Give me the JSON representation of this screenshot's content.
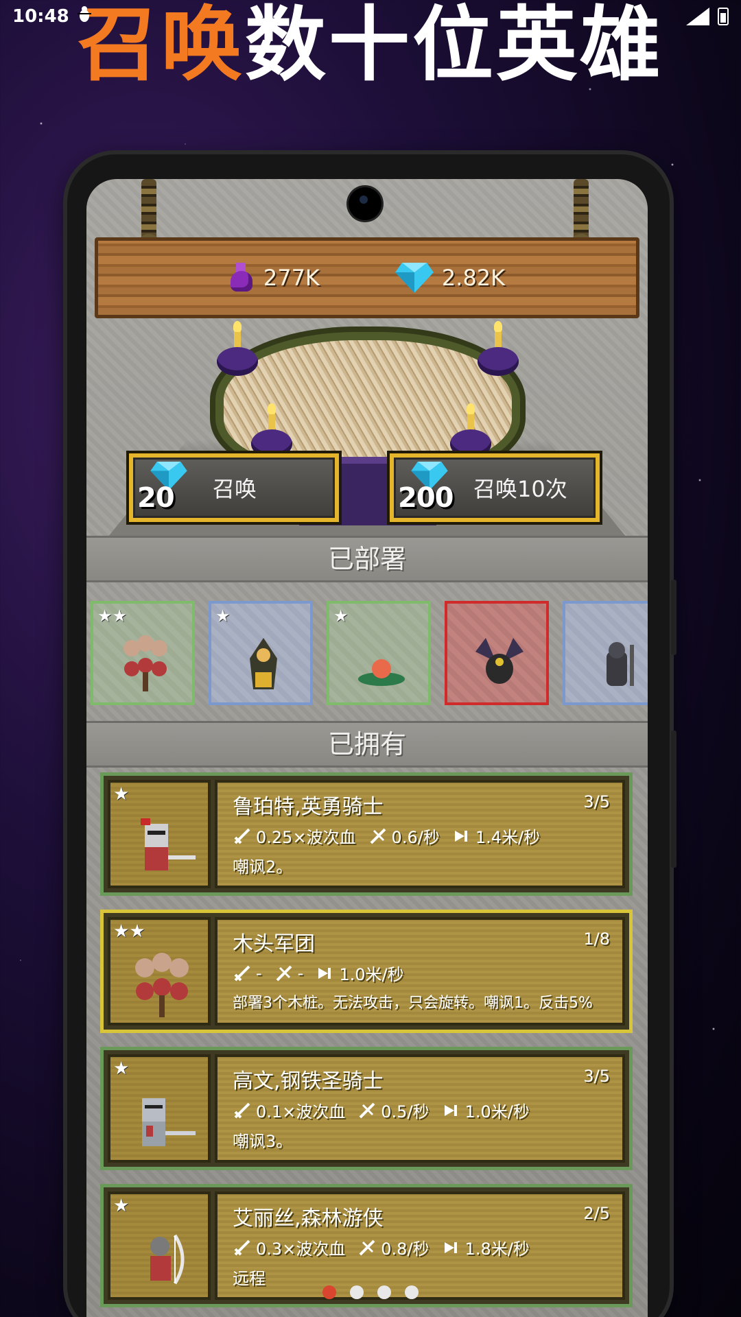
{
  "status_bar": {
    "time": "10:48",
    "notification_icon": "bug-icon"
  },
  "headline": {
    "highlight": "召唤",
    "rest": "数十位英雄"
  },
  "currency": {
    "potion": "277K",
    "gems": "2.82K"
  },
  "summon": [
    {
      "cost": "20",
      "label": "召唤"
    },
    {
      "cost": "200",
      "label": "召唤10次"
    }
  ],
  "sections": {
    "deployed": "已部署",
    "owned": "已拥有"
  },
  "deployed": [
    {
      "stars": 2,
      "rarity": "green",
      "unit": "wood-army"
    },
    {
      "stars": 1,
      "rarity": "blue",
      "unit": "ranger"
    },
    {
      "stars": 1,
      "rarity": "green",
      "unit": "slime"
    },
    {
      "stars": 0,
      "rarity": "red",
      "unit": "dragon"
    },
    {
      "stars": 0,
      "rarity": "blue",
      "unit": "armored-knight"
    }
  ],
  "heroes": [
    {
      "name": "鲁珀特,英勇骑士",
      "count": "3/5",
      "stars": 1,
      "damage": "0.25×波次血",
      "speed": "0.6/秒",
      "move": "1.4米/秒",
      "desc": "嘲讽2。",
      "border": "green"
    },
    {
      "name": "木头军团",
      "count": "1/8",
      "stars": 2,
      "damage": "-",
      "speed": "-",
      "move": "1.0米/秒",
      "desc": "部署3个木桩。无法攻击，只会旋转。嘲讽1。反击5%",
      "border": "gold"
    },
    {
      "name": "高文,钢铁圣骑士",
      "count": "3/5",
      "stars": 1,
      "damage": "0.1×波次血",
      "speed": "0.5/秒",
      "move": "1.0米/秒",
      "desc": "嘲讽3。",
      "border": "green"
    },
    {
      "name": "艾丽丝,森林游侠",
      "count": "2/5",
      "stars": 1,
      "damage": "0.3×波次血",
      "speed": "0.8/秒",
      "move": "1.8米/秒",
      "desc": "远程",
      "border": "green"
    }
  ],
  "pager": {
    "count": 4,
    "active": 0
  },
  "colors": {
    "accent": "#f47a22",
    "gold_border": "#e5b52c",
    "active_dot": "#d9452f"
  }
}
